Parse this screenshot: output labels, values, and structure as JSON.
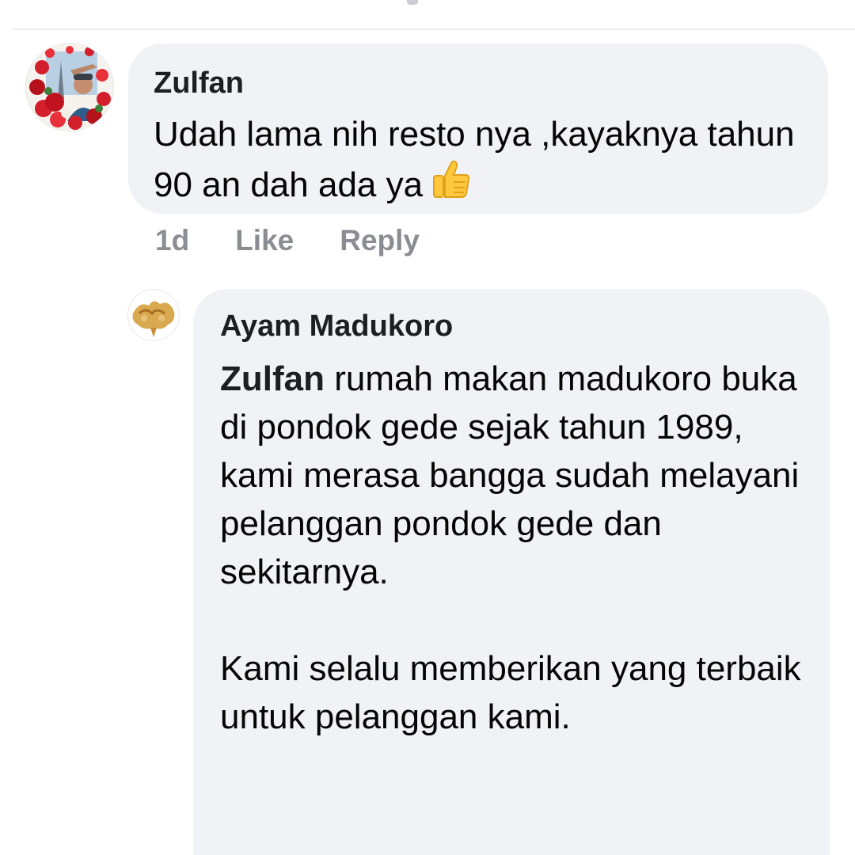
{
  "comments": [
    {
      "author": "Zulfan",
      "text": "Udah lama nih resto nya ,kayaknya tahun 90 an dah ada ya",
      "emoji": "thumbs-up-icon",
      "time": "1d",
      "like_label": "Like",
      "reply_label": "Reply"
    }
  ],
  "replies": [
    {
      "author": "Ayam Madukoro",
      "mention": "Zulfan",
      "text": " rumah makan madukoro buka di pondok gede sejak tahun 1989, kami merasa bangga sudah melayani pelanggan pondok gede dan sekitarnya.\n\nKami selalu memberikan yang terbaik untuk pelanggan kami."
    }
  ],
  "colors": {
    "bubble": "#f0f2f5",
    "author": "#1c1e21",
    "meta": "#8a8d91"
  }
}
